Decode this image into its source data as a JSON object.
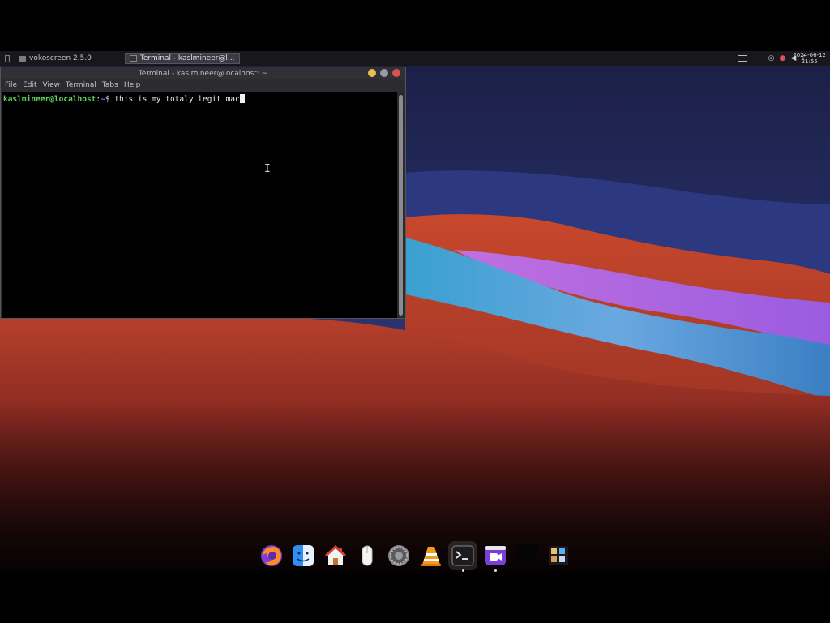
{
  "panel": {
    "apps_glyph": "",
    "tasks": [
      {
        "label": "vokoscreen 2.5.0",
        "active": false
      },
      {
        "label": "Terminal - kaslmineer@l...",
        "active": true
      }
    ],
    "clock": {
      "date": "2024-06-12",
      "time": "21:55"
    }
  },
  "terminal": {
    "title": "Terminal - kaslmineer@localhost: ~",
    "menu": [
      "File",
      "Edit",
      "View",
      "Terminal",
      "Tabs",
      "Help"
    ],
    "prompt_user": "kaslmineer@localhost",
    "prompt_sep": ":",
    "prompt_path": "~",
    "prompt_symbol": "$ ",
    "command": "this is my totaly legit mac"
  },
  "dock": {
    "items": [
      {
        "icon": "firefox-icon"
      },
      {
        "icon": "finder-icon"
      },
      {
        "icon": "home-folder-icon"
      },
      {
        "icon": "mouse-icon"
      },
      {
        "icon": "settings-gear-icon"
      },
      {
        "icon": "vlc-icon"
      },
      {
        "icon": "terminal-icon",
        "active": true
      },
      {
        "icon": "screen-recorder-icon",
        "active": true
      },
      {
        "icon": "blank-app-icon"
      },
      {
        "icon": "app-grid-icon"
      }
    ]
  },
  "colors": {
    "prompt_user": "#5fd75f",
    "prompt_path": "#5f87ff",
    "panel_bg": "#17171c",
    "terminal_bg": "#000000"
  }
}
